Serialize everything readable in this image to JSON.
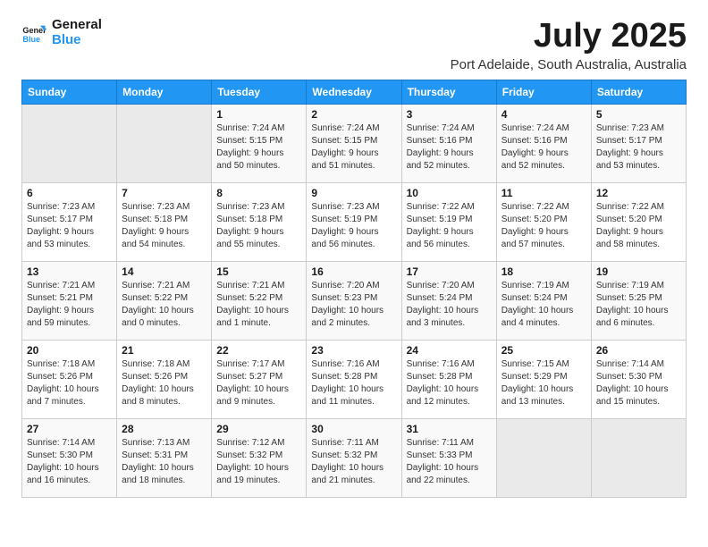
{
  "logo": {
    "line1": "General",
    "line2": "Blue"
  },
  "title": "July 2025",
  "subtitle": "Port Adelaide, South Australia, Australia",
  "days_of_week": [
    "Sunday",
    "Monday",
    "Tuesday",
    "Wednesday",
    "Thursday",
    "Friday",
    "Saturday"
  ],
  "weeks": [
    [
      {
        "num": "",
        "detail": ""
      },
      {
        "num": "",
        "detail": ""
      },
      {
        "num": "1",
        "detail": "Sunrise: 7:24 AM\nSunset: 5:15 PM\nDaylight: 9 hours\nand 50 minutes."
      },
      {
        "num": "2",
        "detail": "Sunrise: 7:24 AM\nSunset: 5:15 PM\nDaylight: 9 hours\nand 51 minutes."
      },
      {
        "num": "3",
        "detail": "Sunrise: 7:24 AM\nSunset: 5:16 PM\nDaylight: 9 hours\nand 52 minutes."
      },
      {
        "num": "4",
        "detail": "Sunrise: 7:24 AM\nSunset: 5:16 PM\nDaylight: 9 hours\nand 52 minutes."
      },
      {
        "num": "5",
        "detail": "Sunrise: 7:23 AM\nSunset: 5:17 PM\nDaylight: 9 hours\nand 53 minutes."
      }
    ],
    [
      {
        "num": "6",
        "detail": "Sunrise: 7:23 AM\nSunset: 5:17 PM\nDaylight: 9 hours\nand 53 minutes."
      },
      {
        "num": "7",
        "detail": "Sunrise: 7:23 AM\nSunset: 5:18 PM\nDaylight: 9 hours\nand 54 minutes."
      },
      {
        "num": "8",
        "detail": "Sunrise: 7:23 AM\nSunset: 5:18 PM\nDaylight: 9 hours\nand 55 minutes."
      },
      {
        "num": "9",
        "detail": "Sunrise: 7:23 AM\nSunset: 5:19 PM\nDaylight: 9 hours\nand 56 minutes."
      },
      {
        "num": "10",
        "detail": "Sunrise: 7:22 AM\nSunset: 5:19 PM\nDaylight: 9 hours\nand 56 minutes."
      },
      {
        "num": "11",
        "detail": "Sunrise: 7:22 AM\nSunset: 5:20 PM\nDaylight: 9 hours\nand 57 minutes."
      },
      {
        "num": "12",
        "detail": "Sunrise: 7:22 AM\nSunset: 5:20 PM\nDaylight: 9 hours\nand 58 minutes."
      }
    ],
    [
      {
        "num": "13",
        "detail": "Sunrise: 7:21 AM\nSunset: 5:21 PM\nDaylight: 9 hours\nand 59 minutes."
      },
      {
        "num": "14",
        "detail": "Sunrise: 7:21 AM\nSunset: 5:22 PM\nDaylight: 10 hours\nand 0 minutes."
      },
      {
        "num": "15",
        "detail": "Sunrise: 7:21 AM\nSunset: 5:22 PM\nDaylight: 10 hours\nand 1 minute."
      },
      {
        "num": "16",
        "detail": "Sunrise: 7:20 AM\nSunset: 5:23 PM\nDaylight: 10 hours\nand 2 minutes."
      },
      {
        "num": "17",
        "detail": "Sunrise: 7:20 AM\nSunset: 5:24 PM\nDaylight: 10 hours\nand 3 minutes."
      },
      {
        "num": "18",
        "detail": "Sunrise: 7:19 AM\nSunset: 5:24 PM\nDaylight: 10 hours\nand 4 minutes."
      },
      {
        "num": "19",
        "detail": "Sunrise: 7:19 AM\nSunset: 5:25 PM\nDaylight: 10 hours\nand 6 minutes."
      }
    ],
    [
      {
        "num": "20",
        "detail": "Sunrise: 7:18 AM\nSunset: 5:26 PM\nDaylight: 10 hours\nand 7 minutes."
      },
      {
        "num": "21",
        "detail": "Sunrise: 7:18 AM\nSunset: 5:26 PM\nDaylight: 10 hours\nand 8 minutes."
      },
      {
        "num": "22",
        "detail": "Sunrise: 7:17 AM\nSunset: 5:27 PM\nDaylight: 10 hours\nand 9 minutes."
      },
      {
        "num": "23",
        "detail": "Sunrise: 7:16 AM\nSunset: 5:28 PM\nDaylight: 10 hours\nand 11 minutes."
      },
      {
        "num": "24",
        "detail": "Sunrise: 7:16 AM\nSunset: 5:28 PM\nDaylight: 10 hours\nand 12 minutes."
      },
      {
        "num": "25",
        "detail": "Sunrise: 7:15 AM\nSunset: 5:29 PM\nDaylight: 10 hours\nand 13 minutes."
      },
      {
        "num": "26",
        "detail": "Sunrise: 7:14 AM\nSunset: 5:30 PM\nDaylight: 10 hours\nand 15 minutes."
      }
    ],
    [
      {
        "num": "27",
        "detail": "Sunrise: 7:14 AM\nSunset: 5:30 PM\nDaylight: 10 hours\nand 16 minutes."
      },
      {
        "num": "28",
        "detail": "Sunrise: 7:13 AM\nSunset: 5:31 PM\nDaylight: 10 hours\nand 18 minutes."
      },
      {
        "num": "29",
        "detail": "Sunrise: 7:12 AM\nSunset: 5:32 PM\nDaylight: 10 hours\nand 19 minutes."
      },
      {
        "num": "30",
        "detail": "Sunrise: 7:11 AM\nSunset: 5:32 PM\nDaylight: 10 hours\nand 21 minutes."
      },
      {
        "num": "31",
        "detail": "Sunrise: 7:11 AM\nSunset: 5:33 PM\nDaylight: 10 hours\nand 22 minutes."
      },
      {
        "num": "",
        "detail": ""
      },
      {
        "num": "",
        "detail": ""
      }
    ]
  ]
}
